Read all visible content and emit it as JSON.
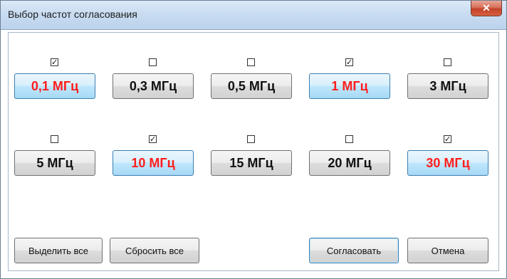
{
  "window": {
    "title": "Выбор частот согласования",
    "close_glyph": "✕"
  },
  "frequencies": [
    {
      "label": "0,1 МГц",
      "checked": true
    },
    {
      "label": "0,3 МГц",
      "checked": false
    },
    {
      "label": "0,5 МГц",
      "checked": false
    },
    {
      "label": "1 МГц",
      "checked": true
    },
    {
      "label": "3 МГц",
      "checked": false
    },
    {
      "label": "5 МГц",
      "checked": false
    },
    {
      "label": "10 МГц",
      "checked": true
    },
    {
      "label": "15 МГц",
      "checked": false
    },
    {
      "label": "20 МГц",
      "checked": false
    },
    {
      "label": "30 МГц",
      "checked": true
    }
  ],
  "buttons": {
    "select_all": "Выделить все",
    "reset_all": "Сбросить все",
    "match": "Согласовать",
    "cancel": "Отмена"
  },
  "colors": {
    "selected_text": "#ff1e1e",
    "selected_fill": "#bee6fd"
  }
}
